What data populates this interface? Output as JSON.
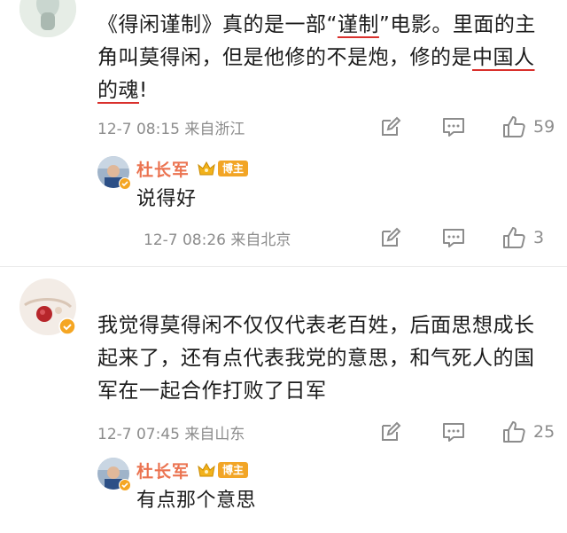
{
  "comments": [
    {
      "text_parts": [
        "《得闲谨制》真的是一部“",
        "谨制",
        "”电影。里面的主角叫莫得闲，但是他修的不是炮，修的是",
        "中国人的魂",
        "!"
      ],
      "time": "12-7 08:15 来自浙江",
      "likes": "59",
      "reply": {
        "author": "杜长军",
        "badge": "博主",
        "text": "说得好",
        "time": "12-7 08:26 来自北京",
        "likes": "3"
      }
    },
    {
      "text": "我觉得莫得闲不仅仅代表老百姓，后面思想成长起来了，还有点代表我党的意思，和气死人的国军在一起合作打败了日军",
      "time": "12-7 07:45 来自山东",
      "likes": "25",
      "reply": {
        "author": "杜长军",
        "badge": "博主",
        "text": "有点那个意思"
      }
    }
  ],
  "colors": {
    "author": "#eb7350",
    "underline": "#d9302c",
    "badge": "#f2a526",
    "meta": "#8c8c8c",
    "verified": "#f5a623"
  },
  "icons": [
    "edit-icon",
    "comment-icon",
    "like-icon",
    "crown-icon",
    "verified-icon"
  ]
}
